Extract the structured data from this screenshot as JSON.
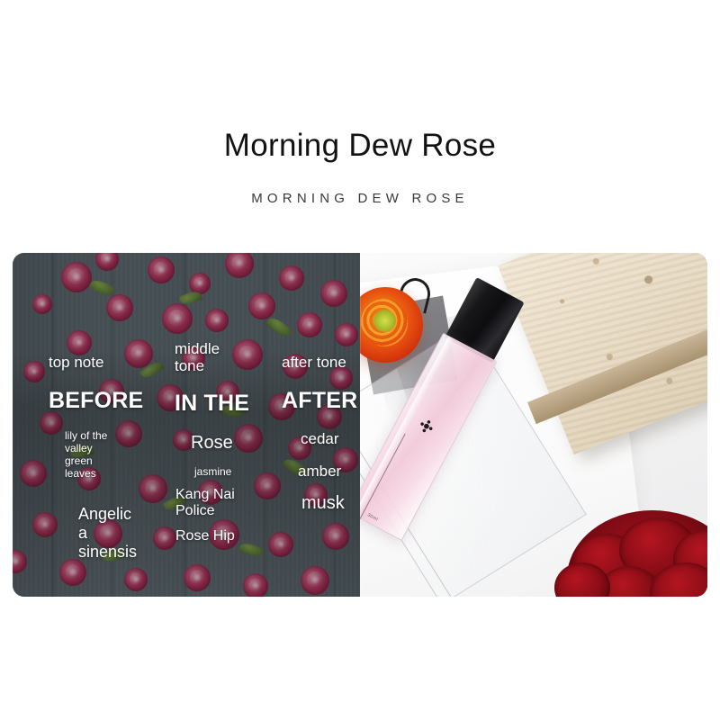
{
  "header": {
    "title": "Morning Dew Rose",
    "subtitle": "MORNING DEW ROSE"
  },
  "notes_panel": {
    "columns": [
      {
        "head": "top note",
        "big": "BEFORE",
        "items": [
          "lily of the valley",
          "green leaves",
          "Angelica sinensis"
        ],
        "item_lines": {
          "small": "lily of the\nvalley\ngreen\nleaves",
          "mid": "Angelic\na\nsinensis"
        }
      },
      {
        "head": "middle tone",
        "big": "IN THE",
        "items": [
          "Rose",
          "jasmine",
          "Kang Nai Police",
          "Rose Hip"
        ],
        "item_lines": {
          "rose": "Rose",
          "jasmine": "jasmine",
          "kang": "Kang Nai\nPolice",
          "hip": "Rose Hip"
        }
      },
      {
        "head": "after tone",
        "big": "AFTER",
        "items": [
          "cedar",
          "amber",
          "musk"
        ],
        "item_lines": {
          "a": "cedar",
          "b": "amber",
          "c": "musk"
        }
      }
    ]
  },
  "product_photo": {
    "bottle_microtext": "30ml",
    "objects": [
      "perfume-bottle",
      "travertine-slab",
      "orange-ranunculus",
      "red-rose",
      "acrylic-sheet"
    ]
  },
  "colors": {
    "title": "#121212",
    "subtitle": "#39393b",
    "panel_bg_left": "#5c666a",
    "rose_pink": "#cf4e79",
    "bottle_liquid": "#f1c7d8",
    "cap_black": "#0d0d10",
    "stone_beige": "#e8dcc6",
    "ranunculus_orange": "#e8540f",
    "red_rose": "#8a0d18",
    "page_bg": "#ffffff"
  }
}
